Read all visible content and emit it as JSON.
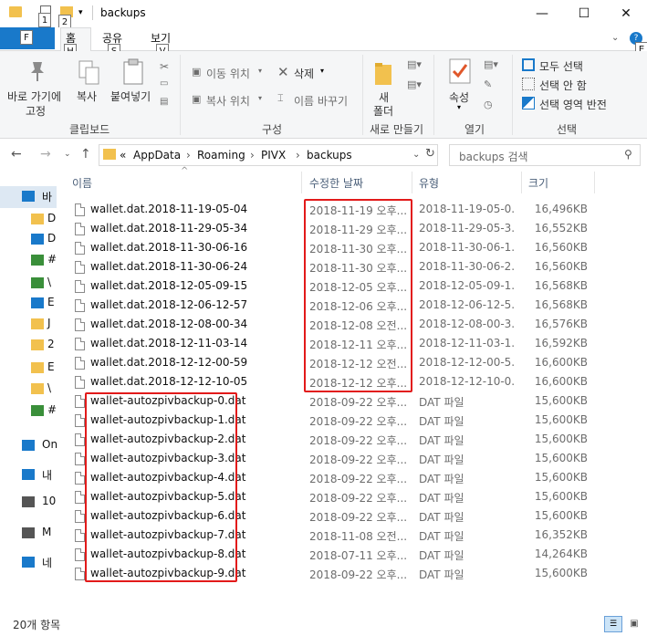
{
  "window": {
    "title": "backups",
    "qat_keys": [
      "1",
      "2"
    ],
    "minimize": "—",
    "maximize": "☐",
    "close": "✕"
  },
  "ribbon_tabs": {
    "file": "파일",
    "file_key": "F",
    "home": "홈",
    "home_key": "H",
    "share": "공유",
    "share_key": "S",
    "view": "보기",
    "view_key": "V",
    "help_key": "E"
  },
  "ribbon": {
    "pin_label_1": "바로 가기에",
    "pin_label_2": "고정",
    "copy": "복사",
    "paste": "붙여넣기",
    "clipboard_group": "클립보드",
    "move_to": "이동 위치",
    "copy_to": "복사 위치",
    "delete": "삭제",
    "rename": "이름 바꾸기",
    "organize_group": "구성",
    "new_folder_1": "새",
    "new_folder_2": "폴더",
    "new_group": "새로 만들기",
    "properties": "속성",
    "open_group": "열기",
    "select_all": "모두 선택",
    "select_none": "선택 안 함",
    "invert_selection": "선택 영역 반전",
    "select_group": "선택"
  },
  "address": {
    "crumbs": [
      "AppData",
      "Roaming",
      "PIVX",
      "backups"
    ],
    "search_placeholder": "backups 검색"
  },
  "columns": {
    "name": "이름",
    "date": "수정한 날짜",
    "type": "유형",
    "size": "크기"
  },
  "sidebar": {
    "items": [
      "바",
      "D",
      "D",
      "#",
      "\\",
      "E",
      "J",
      "2",
      "E",
      "\\",
      "#",
      "On",
      "내",
      "10",
      "M",
      "네"
    ]
  },
  "files": [
    {
      "name": "wallet.dat.2018-11-19-05-04",
      "date": "2018-11-19 오후...",
      "type": "2018-11-19-05-0...",
      "size": "16,496KB"
    },
    {
      "name": "wallet.dat.2018-11-29-05-34",
      "date": "2018-11-29 오후...",
      "type": "2018-11-29-05-3...",
      "size": "16,552KB"
    },
    {
      "name": "wallet.dat.2018-11-30-06-16",
      "date": "2018-11-30 오후...",
      "type": "2018-11-30-06-1...",
      "size": "16,560KB"
    },
    {
      "name": "wallet.dat.2018-11-30-06-24",
      "date": "2018-11-30 오후...",
      "type": "2018-11-30-06-2...",
      "size": "16,560KB"
    },
    {
      "name": "wallet.dat.2018-12-05-09-15",
      "date": "2018-12-05 오후...",
      "type": "2018-12-05-09-1...",
      "size": "16,568KB"
    },
    {
      "name": "wallet.dat.2018-12-06-12-57",
      "date": "2018-12-06 오후...",
      "type": "2018-12-06-12-5...",
      "size": "16,568KB"
    },
    {
      "name": "wallet.dat.2018-12-08-00-34",
      "date": "2018-12-08 오전...",
      "type": "2018-12-08-00-3...",
      "size": "16,576KB"
    },
    {
      "name": "wallet.dat.2018-12-11-03-14",
      "date": "2018-12-11 오후...",
      "type": "2018-12-11-03-1...",
      "size": "16,592KB"
    },
    {
      "name": "wallet.dat.2018-12-12-00-59",
      "date": "2018-12-12 오전...",
      "type": "2018-12-12-00-5...",
      "size": "16,600KB"
    },
    {
      "name": "wallet.dat.2018-12-12-10-05",
      "date": "2018-12-12 오후...",
      "type": "2018-12-12-10-0...",
      "size": "16,600KB"
    },
    {
      "name": "wallet-autozpivbackup-0.dat",
      "date": "2018-09-22 오후...",
      "type": "DAT 파일",
      "size": "15,600KB"
    },
    {
      "name": "wallet-autozpivbackup-1.dat",
      "date": "2018-09-22 오후...",
      "type": "DAT 파일",
      "size": "15,600KB"
    },
    {
      "name": "wallet-autozpivbackup-2.dat",
      "date": "2018-09-22 오후...",
      "type": "DAT 파일",
      "size": "15,600KB"
    },
    {
      "name": "wallet-autozpivbackup-3.dat",
      "date": "2018-09-22 오후...",
      "type": "DAT 파일",
      "size": "15,600KB"
    },
    {
      "name": "wallet-autozpivbackup-4.dat",
      "date": "2018-09-22 오후...",
      "type": "DAT 파일",
      "size": "15,600KB"
    },
    {
      "name": "wallet-autozpivbackup-5.dat",
      "date": "2018-09-22 오후...",
      "type": "DAT 파일",
      "size": "15,600KB"
    },
    {
      "name": "wallet-autozpivbackup-6.dat",
      "date": "2018-09-22 오후...",
      "type": "DAT 파일",
      "size": "15,600KB"
    },
    {
      "name": "wallet-autozpivbackup-7.dat",
      "date": "2018-11-08 오전...",
      "type": "DAT 파일",
      "size": "16,352KB"
    },
    {
      "name": "wallet-autozpivbackup-8.dat",
      "date": "2018-07-11 오후...",
      "type": "DAT 파일",
      "size": "14,264KB"
    },
    {
      "name": "wallet-autozpivbackup-9.dat",
      "date": "2018-09-22 오후...",
      "type": "DAT 파일",
      "size": "15,600KB"
    }
  ],
  "status": {
    "count": "20개 항목"
  },
  "colors": {
    "accent": "#1979ca",
    "highlight_box": "#e21a1a"
  }
}
